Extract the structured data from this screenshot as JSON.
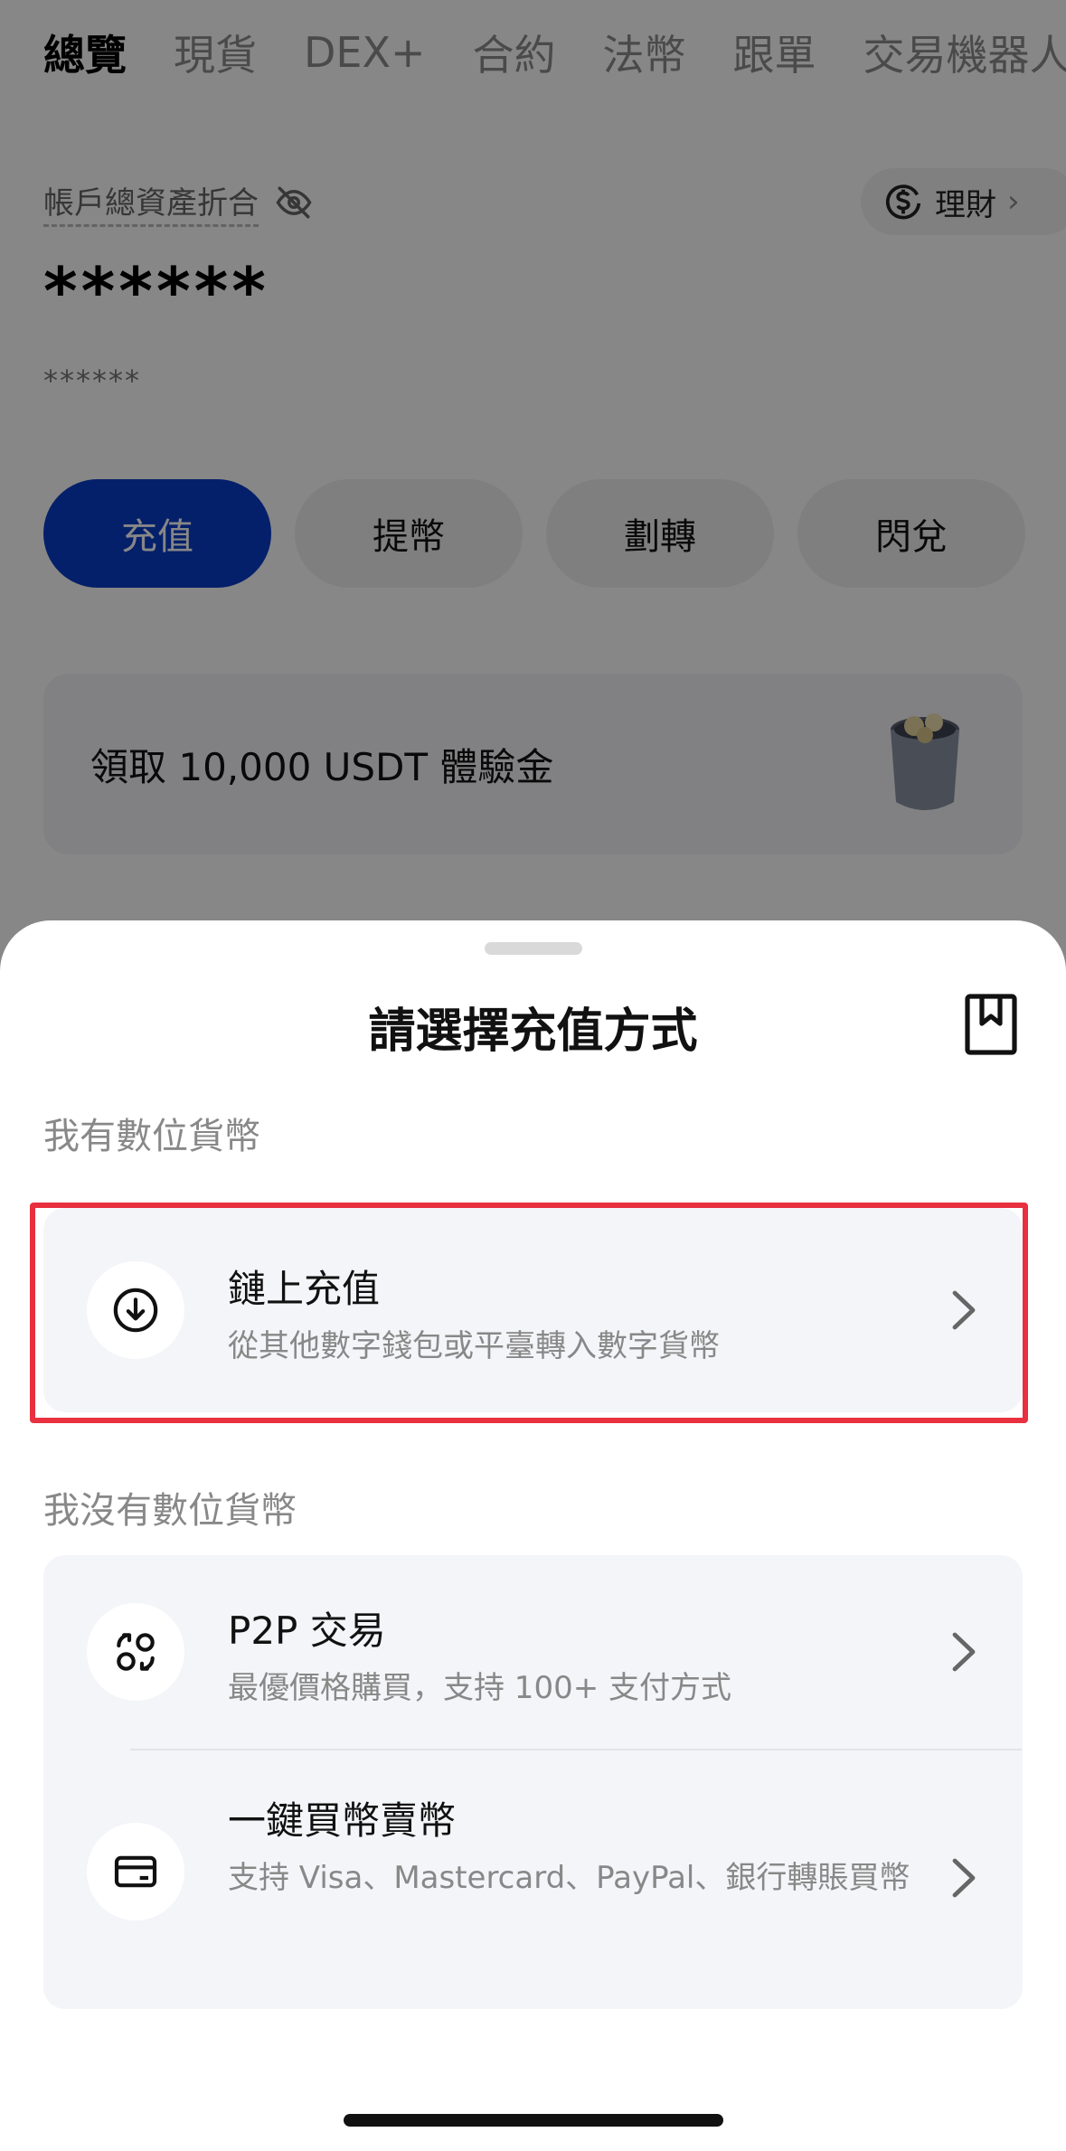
{
  "tabs": [
    "總覽",
    "現貨",
    "DEX+",
    "合約",
    "法幣",
    "跟單",
    "交易機器人"
  ],
  "account": {
    "total_assets_label": "帳戶總資產折合",
    "finance_button": "理財",
    "balance_masked": "******",
    "balance_sub_masked": "******"
  },
  "actions": {
    "deposit": "充值",
    "withdraw": "提幣",
    "transfer": "劃轉",
    "convert": "閃兌"
  },
  "promo": {
    "text": "領取 10,000 USDT 體驗金"
  },
  "sheet": {
    "title": "請選擇充值方式",
    "have_crypto_label": "我有數位貨幣",
    "no_crypto_label": "我沒有數位貨幣",
    "onchain": {
      "title": "鏈上充值",
      "subtitle": "從其他數字錢包或平臺轉入數字貨幣"
    },
    "p2p": {
      "title": "P2P 交易",
      "subtitle": "最優價格購買，支持 100+ 支付方式"
    },
    "quick_buy": {
      "title": "一鍵買幣賣幣",
      "subtitle": "支持 Visa、Mastercard、PayPal、銀行轉賬買幣"
    }
  },
  "colors": {
    "primary_blue": "#0a3ec8",
    "highlight_red": "#e8303f"
  },
  "icons": [
    "eye-off-icon",
    "dollar-circle-icon",
    "chevron-right-icon",
    "bookmark-icon",
    "download-circle-icon",
    "p2p-swap-icon",
    "card-icon"
  ]
}
